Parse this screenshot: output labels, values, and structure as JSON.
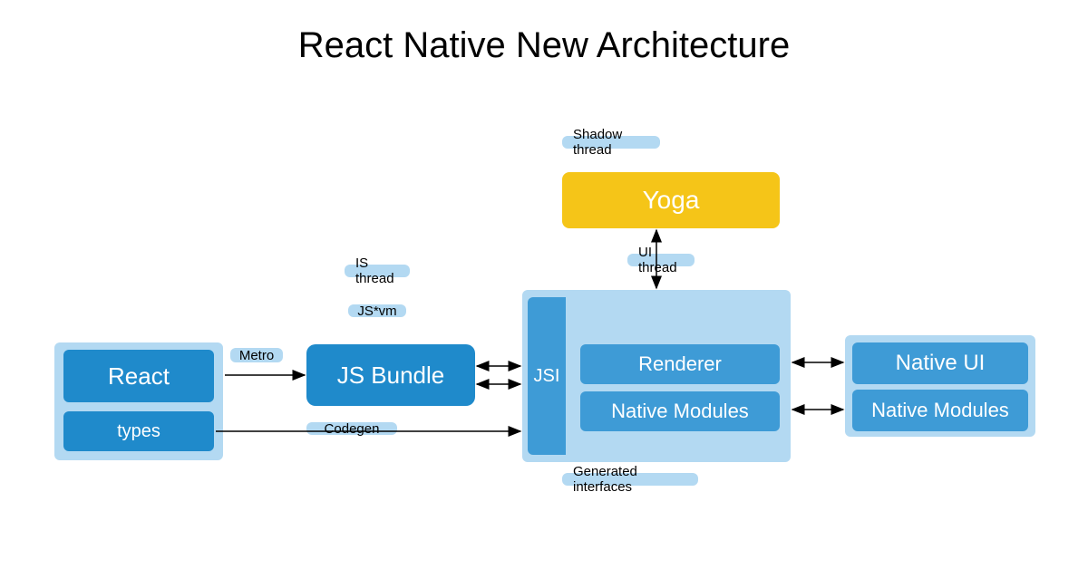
{
  "title": "React Native New Architecture",
  "react_container": {
    "react": "React",
    "types": "types"
  },
  "labels": {
    "metro": "Metro",
    "is_thread": "IS thread",
    "js_vm": "JS*vm",
    "codegen": "Codegen",
    "shadow_thread": "Shadow thread",
    "ui_thread": "UI thread",
    "generated_interfaces": "Generated interfaces"
  },
  "js_bundle": "JS Bundle",
  "yoga": "Yoga",
  "jsi": "JSI",
  "jsi_items": {
    "renderer": "Renderer",
    "native_modules": "Native Modules"
  },
  "native_container": {
    "native_ui": "Native UI",
    "native_modules": "Native Modules"
  }
}
